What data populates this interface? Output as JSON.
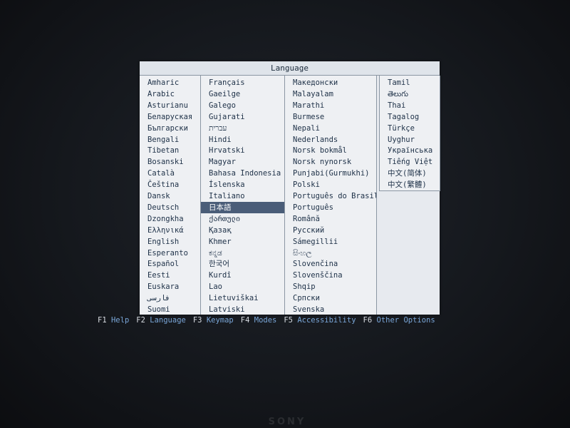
{
  "dialog": {
    "title": "Language",
    "columns": [
      [
        "Amharic",
        "Arabic",
        "Asturianu",
        "Беларуская",
        "Български",
        "Bengali",
        "Tibetan",
        "Bosanski",
        "Català",
        "Čeština",
        "Dansk",
        "Deutsch",
        "Dzongkha",
        "Ελληνικά",
        "English",
        "Esperanto",
        "Español",
        "Eesti",
        "Euskara",
        "فارسی",
        "Suomi"
      ],
      [
        "Français",
        "Gaeilge",
        "Galego",
        "Gujarati",
        "עברית",
        "Hindi",
        "Hrvatski",
        "Magyar",
        "Bahasa Indonesia",
        "Íslenska",
        "Italiano",
        "日本語",
        "ქართული",
        "Қазақ",
        "Khmer",
        "ಕನ್ನಡ",
        "한국어",
        "Kurdî",
        "Lao",
        "Lietuviškai",
        "Latviski"
      ],
      [
        "Македонски",
        "Malayalam",
        "Marathi",
        "Burmese",
        "Nepali",
        "Nederlands",
        "Norsk bokmål",
        "Norsk nynorsk",
        "Punjabi(Gurmukhi)",
        "Polski",
        "Português do Brasil",
        "Português",
        "Română",
        "Русский",
        "Sámegillii",
        "සිංහල",
        "Slovenčina",
        "Slovenščina",
        "Shqip",
        "Српски",
        "Svenska"
      ],
      [
        "Tamil",
        "తెలుగు",
        "Thai",
        "Tagalog",
        "Türkçe",
        "Uyghur",
        "Українська",
        "Tiếng Việt",
        "中文(简体)",
        "中文(繁體)"
      ]
    ],
    "selected": "日本語"
  },
  "function_keys": [
    {
      "key": "F1",
      "label": "Help"
    },
    {
      "key": "F2",
      "label": "Language"
    },
    {
      "key": "F3",
      "label": "Keymap"
    },
    {
      "key": "F4",
      "label": "Modes"
    },
    {
      "key": "F5",
      "label": "Accessibility"
    },
    {
      "key": "F6",
      "label": "Other Options"
    }
  ],
  "monitor_brand": "SONY"
}
